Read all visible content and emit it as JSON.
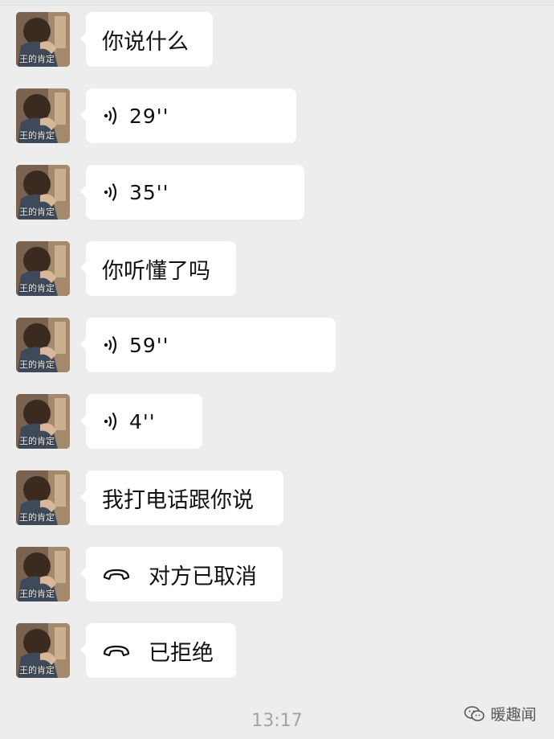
{
  "contact": {
    "avatar_caption": "王的肯定"
  },
  "messages": [
    {
      "type": "text",
      "text": "你说什么"
    },
    {
      "type": "voice",
      "duration": "29''"
    },
    {
      "type": "voice",
      "duration": "35''"
    },
    {
      "type": "text",
      "text": "你听懂了吗"
    },
    {
      "type": "voice",
      "duration": "59''"
    },
    {
      "type": "voice",
      "duration": "4''"
    },
    {
      "type": "text",
      "text": "我打电话跟你说"
    },
    {
      "type": "call",
      "text": "对方已取消"
    },
    {
      "type": "call",
      "text": "已拒绝"
    }
  ],
  "timestamp": "13:17",
  "watermark": {
    "text": "暖趣闻",
    "icon": "wechat-official-account-icon"
  },
  "colors": {
    "background": "#ededed",
    "bubble": "#ffffff",
    "text": "#111111",
    "timestamp": "#a3a3a3"
  }
}
